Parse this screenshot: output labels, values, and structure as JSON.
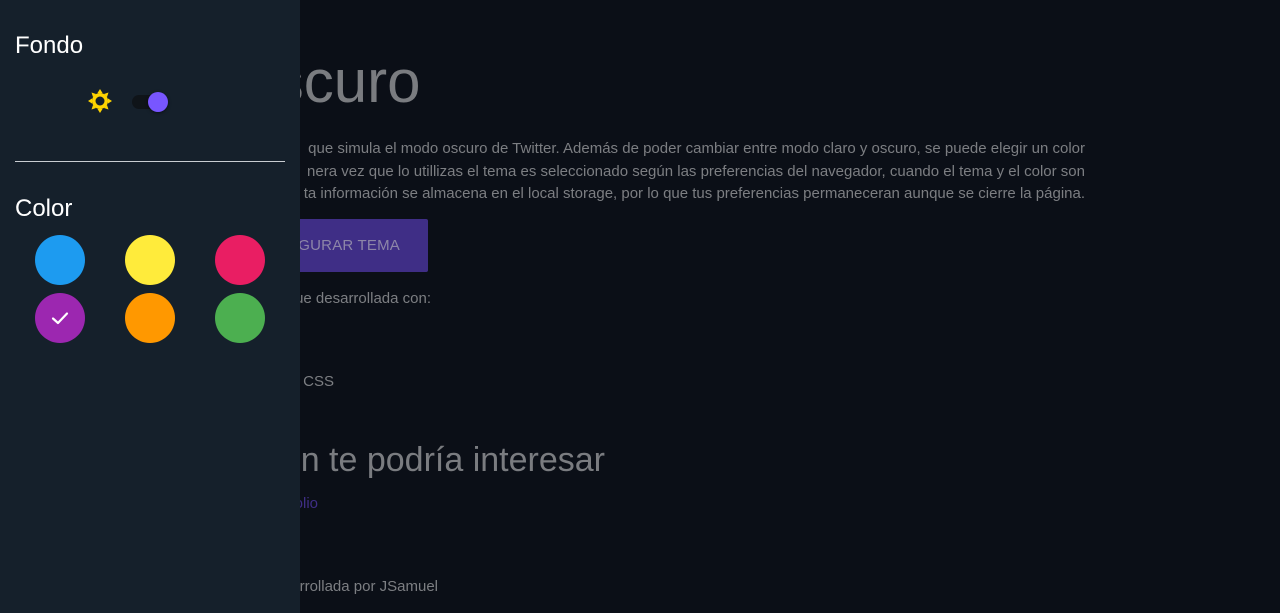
{
  "main": {
    "title": "do oscuro",
    "description_lines": [
      "que simula el modo oscuro de Twitter. Además de poder cambiar entre modo claro y oscuro, se puede elegir un color",
      "nera vez que lo utillizas el tema es seleccionado según las preferencias del navegador, cuando el tema y el color son",
      "ta información se almacena en el local storage, por lo que tus preferencias permaneceran aunque se cierre la página."
    ],
    "config_button_label": "IGURAR TEMA",
    "built_with_text": "ue desarrollada con:",
    "css_item": "e CSS",
    "interest_title": "n te podría interesar",
    "portfolio_link": "olio",
    "footer_text": "rrollada por JSamuel"
  },
  "panel": {
    "background_heading": "Fondo",
    "color_heading": "Color",
    "theme_toggle": {
      "left_icon": "sun-icon",
      "right_icon": "moon-icon",
      "dark_mode_on": true,
      "sun_color": "#ffd400",
      "moon_color": "#3f51b5",
      "knob_color": "#7856ff"
    },
    "colors": [
      {
        "name": "blue",
        "hex": "#1d9bf0",
        "selected": false
      },
      {
        "name": "yellow",
        "hex": "#ffeb3b",
        "selected": false
      },
      {
        "name": "pink",
        "hex": "#e91e63",
        "selected": false
      },
      {
        "name": "purple",
        "hex": "#9c27b0",
        "selected": true
      },
      {
        "name": "orange",
        "hex": "#ff9800",
        "selected": false
      },
      {
        "name": "green",
        "hex": "#4caf50",
        "selected": false
      }
    ]
  },
  "colors": {
    "page_background": "#0b0f17",
    "panel_background": "#15202b",
    "accent_button": "#3f2e86"
  }
}
